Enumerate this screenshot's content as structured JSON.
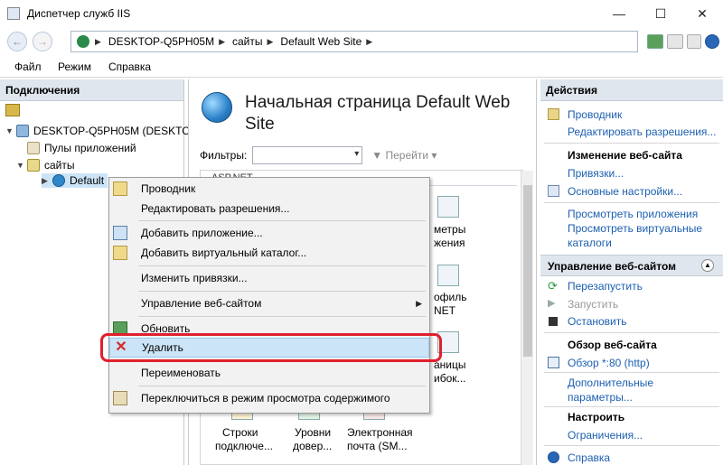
{
  "window": {
    "title": "Диспетчер служб IIS",
    "minimize_icon": "minimize-icon",
    "maximize_icon": "maximize-icon",
    "close_icon": "close-icon"
  },
  "address": {
    "segments": [
      "DESKTOP-Q5PH05M",
      "сайты",
      "Default Web Site"
    ]
  },
  "menu": [
    "Файл",
    "Режим",
    "Справка"
  ],
  "connections": {
    "header": "Подключения",
    "tree": [
      {
        "label": "DESKTOP-Q5PH05M (DESKTO",
        "expanded": true
      },
      {
        "label": "Пулы приложений"
      },
      {
        "label": "сайты",
        "expanded": true
      },
      {
        "label": "Default"
      }
    ]
  },
  "main": {
    "title": "Начальная страница Default Web Site",
    "filter_label": "Фильтры:",
    "go_label": "Перейти",
    "group_label": "ASP.NET",
    "features_partial": [
      "метры",
      "жения",
      "офиль",
      "NET",
      "аницы",
      "ибок..."
    ],
    "features": [
      {
        "line1": "Строки",
        "line2": "подключе..."
      },
      {
        "line1": "Уровни",
        "line2": "довер..."
      },
      {
        "line1": "Электронная",
        "line2": "почта (SM..."
      }
    ]
  },
  "actions": {
    "header": "Действия",
    "top": [
      "Проводник",
      "Редактировать разрешения..."
    ],
    "edit_site_header": "Изменение веб-сайта",
    "edit_site": [
      "Привязки...",
      "Основные настройки..."
    ],
    "view_apps": "Просмотреть приложения",
    "view_vdirs_1": "Просмотреть виртуальные",
    "view_vdirs_2": "каталоги",
    "manage_header": "Управление веб-сайтом",
    "manage": {
      "restart": "Перезапустить",
      "start": "Запустить",
      "stop": "Остановить"
    },
    "browse_header": "Обзор веб-сайта",
    "browse_link": "Обзор *:80 (http)",
    "advanced_1": "Дополнительные",
    "advanced_2": "параметры...",
    "configure_header": "Настроить",
    "limits": "Ограничения...",
    "help": "Справка"
  },
  "context_menu": {
    "items": [
      {
        "label": "Проводник"
      },
      {
        "label": "Редактировать разрешения..."
      },
      {
        "label": "Добавить приложение..."
      },
      {
        "label": "Добавить виртуальный каталог..."
      },
      {
        "label": "Изменить привязки..."
      },
      {
        "label": "Управление веб-сайтом"
      },
      {
        "label": "Обновить"
      },
      {
        "label": "Удалить",
        "highlighted": true
      },
      {
        "label": "Переименовать"
      },
      {
        "label": "Переключиться в режим просмотра содержимого"
      }
    ]
  },
  "colors": {
    "link": "#1c5fb0",
    "highlight": "#cce4f7",
    "callout": "#e0202c",
    "pane_header": "#dfe6ee"
  }
}
